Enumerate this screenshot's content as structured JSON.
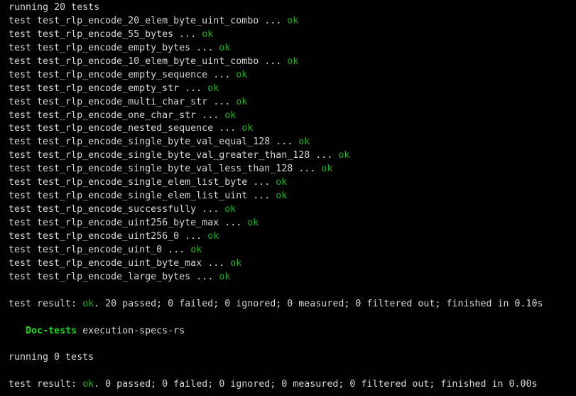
{
  "terminal": {
    "background_color": "#000000",
    "default_text_color": "#d6d6d6",
    "ok_color": "#2ea82e",
    "heading_color": "#17d917",
    "lines": [
      {
        "name": "running-header",
        "segments": [
          {
            "text": "running 20 tests",
            "style": "default"
          }
        ]
      },
      {
        "name": "test-result-line",
        "segments": [
          {
            "text": "test test_rlp_encode_20_elem_byte_uint_combo ... ",
            "style": "default"
          },
          {
            "text": "ok",
            "style": "ok"
          }
        ]
      },
      {
        "name": "test-result-line",
        "segments": [
          {
            "text": "test test_rlp_encode_55_bytes ... ",
            "style": "default"
          },
          {
            "text": "ok",
            "style": "ok"
          }
        ]
      },
      {
        "name": "test-result-line",
        "segments": [
          {
            "text": "test test_rlp_encode_empty_bytes ... ",
            "style": "default"
          },
          {
            "text": "ok",
            "style": "ok"
          }
        ]
      },
      {
        "name": "test-result-line",
        "segments": [
          {
            "text": "test test_rlp_encode_10_elem_byte_uint_combo ... ",
            "style": "default"
          },
          {
            "text": "ok",
            "style": "ok"
          }
        ]
      },
      {
        "name": "test-result-line",
        "segments": [
          {
            "text": "test test_rlp_encode_empty_sequence ... ",
            "style": "default"
          },
          {
            "text": "ok",
            "style": "ok"
          }
        ]
      },
      {
        "name": "test-result-line",
        "segments": [
          {
            "text": "test test_rlp_encode_empty_str ... ",
            "style": "default"
          },
          {
            "text": "ok",
            "style": "ok"
          }
        ]
      },
      {
        "name": "test-result-line",
        "segments": [
          {
            "text": "test test_rlp_encode_multi_char_str ... ",
            "style": "default"
          },
          {
            "text": "ok",
            "style": "ok"
          }
        ]
      },
      {
        "name": "test-result-line",
        "segments": [
          {
            "text": "test test_rlp_encode_one_char_str ... ",
            "style": "default"
          },
          {
            "text": "ok",
            "style": "ok"
          }
        ]
      },
      {
        "name": "test-result-line",
        "segments": [
          {
            "text": "test test_rlp_encode_nested_sequence ... ",
            "style": "default"
          },
          {
            "text": "ok",
            "style": "ok"
          }
        ]
      },
      {
        "name": "test-result-line",
        "segments": [
          {
            "text": "test test_rlp_encode_single_byte_val_equal_128 ... ",
            "style": "default"
          },
          {
            "text": "ok",
            "style": "ok"
          }
        ]
      },
      {
        "name": "test-result-line",
        "segments": [
          {
            "text": "test test_rlp_encode_single_byte_val_greater_than_128 ... ",
            "style": "default"
          },
          {
            "text": "ok",
            "style": "ok"
          }
        ]
      },
      {
        "name": "test-result-line",
        "segments": [
          {
            "text": "test test_rlp_encode_single_byte_val_less_than_128 ... ",
            "style": "default"
          },
          {
            "text": "ok",
            "style": "ok"
          }
        ]
      },
      {
        "name": "test-result-line",
        "segments": [
          {
            "text": "test test_rlp_encode_single_elem_list_byte ... ",
            "style": "default"
          },
          {
            "text": "ok",
            "style": "ok"
          }
        ]
      },
      {
        "name": "test-result-line",
        "segments": [
          {
            "text": "test test_rlp_encode_single_elem_list_uint ... ",
            "style": "default"
          },
          {
            "text": "ok",
            "style": "ok"
          }
        ]
      },
      {
        "name": "test-result-line",
        "segments": [
          {
            "text": "test test_rlp_encode_successfully ... ",
            "style": "default"
          },
          {
            "text": "ok",
            "style": "ok"
          }
        ]
      },
      {
        "name": "test-result-line",
        "segments": [
          {
            "text": "test test_rlp_encode_uint256_byte_max ... ",
            "style": "default"
          },
          {
            "text": "ok",
            "style": "ok"
          }
        ]
      },
      {
        "name": "test-result-line",
        "segments": [
          {
            "text": "test test_rlp_encode_uint256_0 ... ",
            "style": "default"
          },
          {
            "text": "ok",
            "style": "ok"
          }
        ]
      },
      {
        "name": "test-result-line",
        "segments": [
          {
            "text": "test test_rlp_encode_uint_0 ... ",
            "style": "default"
          },
          {
            "text": "ok",
            "style": "ok"
          }
        ]
      },
      {
        "name": "test-result-line",
        "segments": [
          {
            "text": "test test_rlp_encode_uint_byte_max ... ",
            "style": "default"
          },
          {
            "text": "ok",
            "style": "ok"
          }
        ]
      },
      {
        "name": "test-result-line",
        "segments": [
          {
            "text": "test test_rlp_encode_large_bytes ... ",
            "style": "default"
          },
          {
            "text": "ok",
            "style": "ok"
          }
        ]
      },
      {
        "name": "blank-line",
        "segments": []
      },
      {
        "name": "test-summary-line",
        "segments": [
          {
            "text": "test result: ",
            "style": "default"
          },
          {
            "text": "ok",
            "style": "ok"
          },
          {
            "text": ". 20 passed; 0 failed; 0 ignored; 0 measured; 0 filtered out; finished in 0.10s",
            "style": "default"
          }
        ]
      },
      {
        "name": "blank-line",
        "segments": []
      },
      {
        "name": "doc-tests-header",
        "segments": [
          {
            "text": "   ",
            "style": "default"
          },
          {
            "text": "Doc-tests",
            "style": "bright-green"
          },
          {
            "text": " execution-specs-rs",
            "style": "default"
          }
        ]
      },
      {
        "name": "blank-line",
        "segments": []
      },
      {
        "name": "running-header",
        "segments": [
          {
            "text": "running 0 tests",
            "style": "default"
          }
        ]
      },
      {
        "name": "blank-line",
        "segments": []
      },
      {
        "name": "test-summary-line",
        "segments": [
          {
            "text": "test result: ",
            "style": "default"
          },
          {
            "text": "ok",
            "style": "ok"
          },
          {
            "text": ". 0 passed; 0 failed; 0 ignored; 0 measured; 0 filtered out; finished in 0.00s",
            "style": "default"
          }
        ]
      }
    ]
  }
}
